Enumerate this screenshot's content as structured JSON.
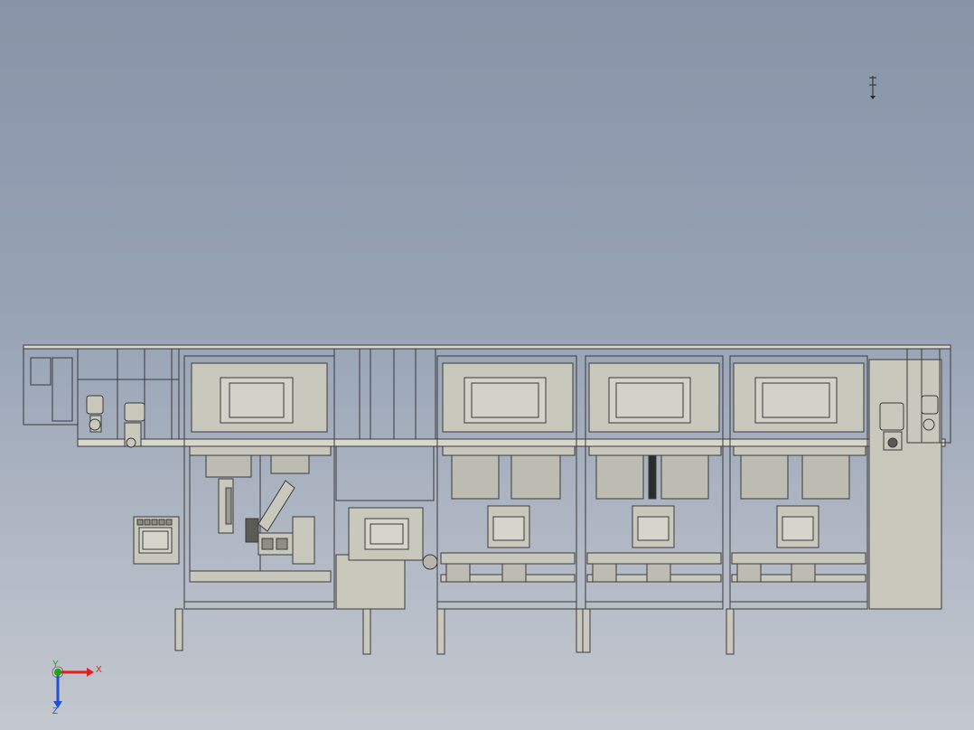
{
  "viewport": {
    "background_top": "#8794a7",
    "background_bottom": "#c3c7ce",
    "model_fill": "#c9c8bd",
    "model_stroke": "#3a3a3a"
  },
  "triad": {
    "x_label": "X",
    "y_label": "Y",
    "z_label": "Z",
    "x_color": "#e0201c",
    "y_color": "#1ca51c",
    "z_color": "#2050d8"
  },
  "modules": {
    "count": 5,
    "hmi_panels": 2,
    "cabinets": 4
  }
}
